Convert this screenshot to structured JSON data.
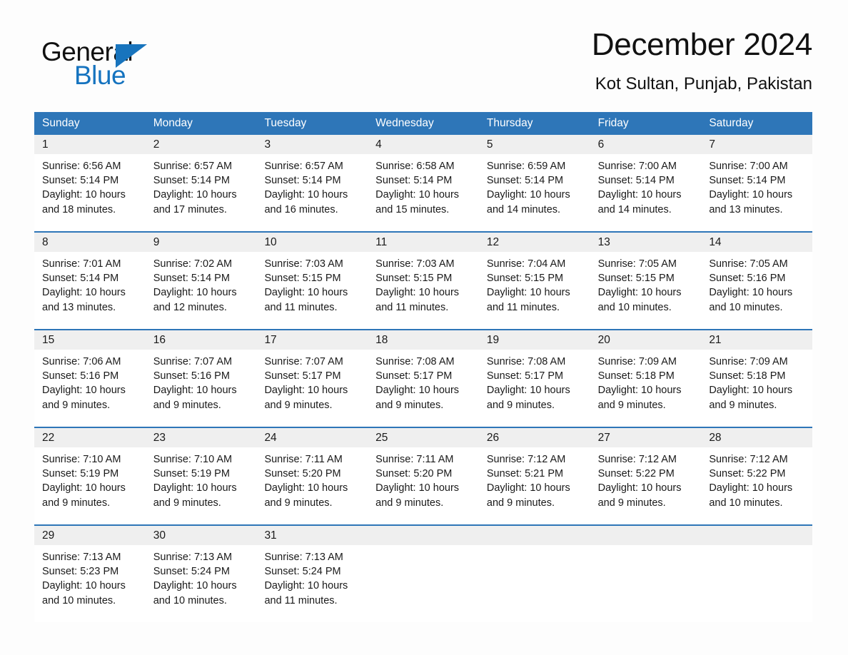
{
  "brand": {
    "name_part1": "General",
    "name_part2": "Blue",
    "triangle_icon": "triangle-icon",
    "accent_color": "#1874bd"
  },
  "header": {
    "month_title": "December 2024",
    "location": "Kot Sultan, Punjab, Pakistan"
  },
  "calendar": {
    "header_color": "#2e76b8",
    "daynum_band_color": "#efefef",
    "weekdays": [
      "Sunday",
      "Monday",
      "Tuesday",
      "Wednesday",
      "Thursday",
      "Friday",
      "Saturday"
    ],
    "weeks": [
      [
        {
          "day": "1",
          "sunrise": "Sunrise: 6:56 AM",
          "sunset": "Sunset: 5:14 PM",
          "daylight_line1": "Daylight: 10 hours",
          "daylight_line2": "and 18 minutes."
        },
        {
          "day": "2",
          "sunrise": "Sunrise: 6:57 AM",
          "sunset": "Sunset: 5:14 PM",
          "daylight_line1": "Daylight: 10 hours",
          "daylight_line2": "and 17 minutes."
        },
        {
          "day": "3",
          "sunrise": "Sunrise: 6:57 AM",
          "sunset": "Sunset: 5:14 PM",
          "daylight_line1": "Daylight: 10 hours",
          "daylight_line2": "and 16 minutes."
        },
        {
          "day": "4",
          "sunrise": "Sunrise: 6:58 AM",
          "sunset": "Sunset: 5:14 PM",
          "daylight_line1": "Daylight: 10 hours",
          "daylight_line2": "and 15 minutes."
        },
        {
          "day": "5",
          "sunrise": "Sunrise: 6:59 AM",
          "sunset": "Sunset: 5:14 PM",
          "daylight_line1": "Daylight: 10 hours",
          "daylight_line2": "and 14 minutes."
        },
        {
          "day": "6",
          "sunrise": "Sunrise: 7:00 AM",
          "sunset": "Sunset: 5:14 PM",
          "daylight_line1": "Daylight: 10 hours",
          "daylight_line2": "and 14 minutes."
        },
        {
          "day": "7",
          "sunrise": "Sunrise: 7:00 AM",
          "sunset": "Sunset: 5:14 PM",
          "daylight_line1": "Daylight: 10 hours",
          "daylight_line2": "and 13 minutes."
        }
      ],
      [
        {
          "day": "8",
          "sunrise": "Sunrise: 7:01 AM",
          "sunset": "Sunset: 5:14 PM",
          "daylight_line1": "Daylight: 10 hours",
          "daylight_line2": "and 13 minutes."
        },
        {
          "day": "9",
          "sunrise": "Sunrise: 7:02 AM",
          "sunset": "Sunset: 5:14 PM",
          "daylight_line1": "Daylight: 10 hours",
          "daylight_line2": "and 12 minutes."
        },
        {
          "day": "10",
          "sunrise": "Sunrise: 7:03 AM",
          "sunset": "Sunset: 5:15 PM",
          "daylight_line1": "Daylight: 10 hours",
          "daylight_line2": "and 11 minutes."
        },
        {
          "day": "11",
          "sunrise": "Sunrise: 7:03 AM",
          "sunset": "Sunset: 5:15 PM",
          "daylight_line1": "Daylight: 10 hours",
          "daylight_line2": "and 11 minutes."
        },
        {
          "day": "12",
          "sunrise": "Sunrise: 7:04 AM",
          "sunset": "Sunset: 5:15 PM",
          "daylight_line1": "Daylight: 10 hours",
          "daylight_line2": "and 11 minutes."
        },
        {
          "day": "13",
          "sunrise": "Sunrise: 7:05 AM",
          "sunset": "Sunset: 5:15 PM",
          "daylight_line1": "Daylight: 10 hours",
          "daylight_line2": "and 10 minutes."
        },
        {
          "day": "14",
          "sunrise": "Sunrise: 7:05 AM",
          "sunset": "Sunset: 5:16 PM",
          "daylight_line1": "Daylight: 10 hours",
          "daylight_line2": "and 10 minutes."
        }
      ],
      [
        {
          "day": "15",
          "sunrise": "Sunrise: 7:06 AM",
          "sunset": "Sunset: 5:16 PM",
          "daylight_line1": "Daylight: 10 hours",
          "daylight_line2": "and 9 minutes."
        },
        {
          "day": "16",
          "sunrise": "Sunrise: 7:07 AM",
          "sunset": "Sunset: 5:16 PM",
          "daylight_line1": "Daylight: 10 hours",
          "daylight_line2": "and 9 minutes."
        },
        {
          "day": "17",
          "sunrise": "Sunrise: 7:07 AM",
          "sunset": "Sunset: 5:17 PM",
          "daylight_line1": "Daylight: 10 hours",
          "daylight_line2": "and 9 minutes."
        },
        {
          "day": "18",
          "sunrise": "Sunrise: 7:08 AM",
          "sunset": "Sunset: 5:17 PM",
          "daylight_line1": "Daylight: 10 hours",
          "daylight_line2": "and 9 minutes."
        },
        {
          "day": "19",
          "sunrise": "Sunrise: 7:08 AM",
          "sunset": "Sunset: 5:17 PM",
          "daylight_line1": "Daylight: 10 hours",
          "daylight_line2": "and 9 minutes."
        },
        {
          "day": "20",
          "sunrise": "Sunrise: 7:09 AM",
          "sunset": "Sunset: 5:18 PM",
          "daylight_line1": "Daylight: 10 hours",
          "daylight_line2": "and 9 minutes."
        },
        {
          "day": "21",
          "sunrise": "Sunrise: 7:09 AM",
          "sunset": "Sunset: 5:18 PM",
          "daylight_line1": "Daylight: 10 hours",
          "daylight_line2": "and 9 minutes."
        }
      ],
      [
        {
          "day": "22",
          "sunrise": "Sunrise: 7:10 AM",
          "sunset": "Sunset: 5:19 PM",
          "daylight_line1": "Daylight: 10 hours",
          "daylight_line2": "and 9 minutes."
        },
        {
          "day": "23",
          "sunrise": "Sunrise: 7:10 AM",
          "sunset": "Sunset: 5:19 PM",
          "daylight_line1": "Daylight: 10 hours",
          "daylight_line2": "and 9 minutes."
        },
        {
          "day": "24",
          "sunrise": "Sunrise: 7:11 AM",
          "sunset": "Sunset: 5:20 PM",
          "daylight_line1": "Daylight: 10 hours",
          "daylight_line2": "and 9 minutes."
        },
        {
          "day": "25",
          "sunrise": "Sunrise: 7:11 AM",
          "sunset": "Sunset: 5:20 PM",
          "daylight_line1": "Daylight: 10 hours",
          "daylight_line2": "and 9 minutes."
        },
        {
          "day": "26",
          "sunrise": "Sunrise: 7:12 AM",
          "sunset": "Sunset: 5:21 PM",
          "daylight_line1": "Daylight: 10 hours",
          "daylight_line2": "and 9 minutes."
        },
        {
          "day": "27",
          "sunrise": "Sunrise: 7:12 AM",
          "sunset": "Sunset: 5:22 PM",
          "daylight_line1": "Daylight: 10 hours",
          "daylight_line2": "and 9 minutes."
        },
        {
          "day": "28",
          "sunrise": "Sunrise: 7:12 AM",
          "sunset": "Sunset: 5:22 PM",
          "daylight_line1": "Daylight: 10 hours",
          "daylight_line2": "and 10 minutes."
        }
      ],
      [
        {
          "day": "29",
          "sunrise": "Sunrise: 7:13 AM",
          "sunset": "Sunset: 5:23 PM",
          "daylight_line1": "Daylight: 10 hours",
          "daylight_line2": "and 10 minutes."
        },
        {
          "day": "30",
          "sunrise": "Sunrise: 7:13 AM",
          "sunset": "Sunset: 5:24 PM",
          "daylight_line1": "Daylight: 10 hours",
          "daylight_line2": "and 10 minutes."
        },
        {
          "day": "31",
          "sunrise": "Sunrise: 7:13 AM",
          "sunset": "Sunset: 5:24 PM",
          "daylight_line1": "Daylight: 10 hours",
          "daylight_line2": "and 11 minutes."
        },
        {
          "day": "",
          "sunrise": "",
          "sunset": "",
          "daylight_line1": "",
          "daylight_line2": ""
        },
        {
          "day": "",
          "sunrise": "",
          "sunset": "",
          "daylight_line1": "",
          "daylight_line2": ""
        },
        {
          "day": "",
          "sunrise": "",
          "sunset": "",
          "daylight_line1": "",
          "daylight_line2": ""
        },
        {
          "day": "",
          "sunrise": "",
          "sunset": "",
          "daylight_line1": "",
          "daylight_line2": ""
        }
      ]
    ]
  }
}
